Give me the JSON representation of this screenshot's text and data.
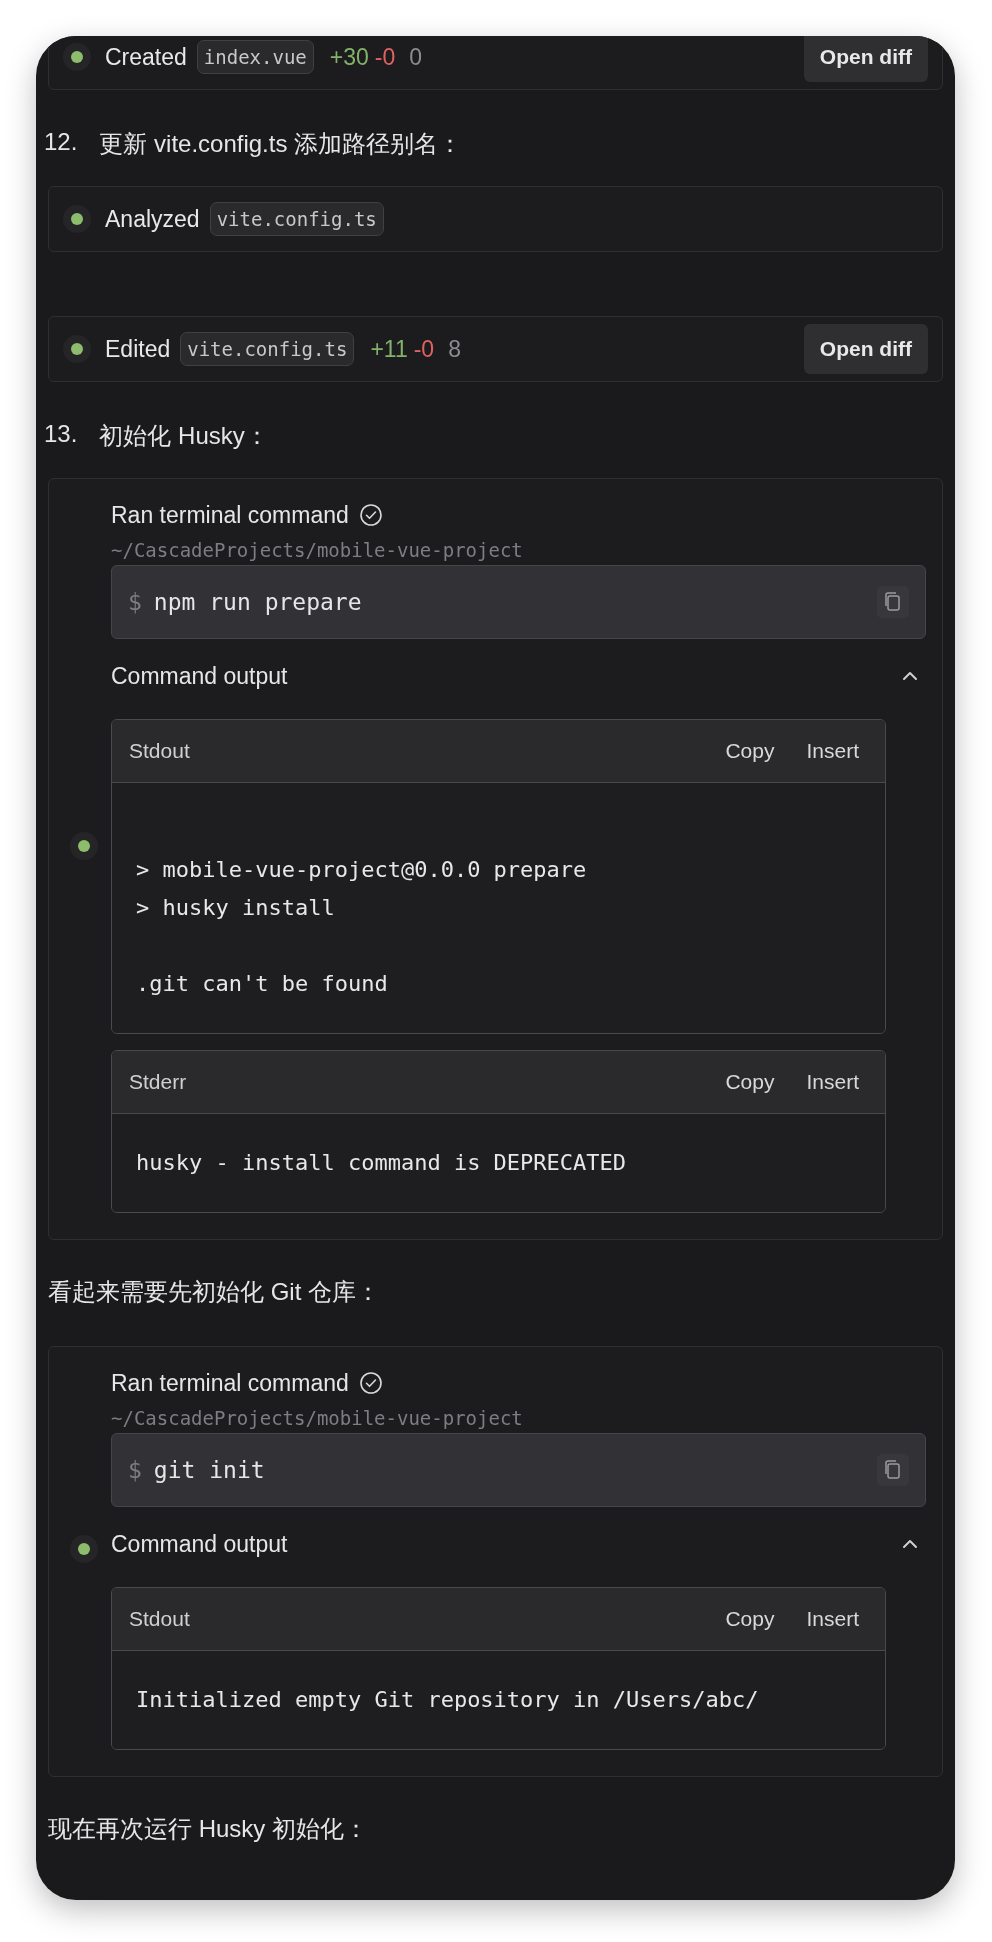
{
  "items": [
    {
      "kind": "file_action",
      "verb": "Created",
      "file": "index.vue",
      "added": "+30",
      "removed": "-0",
      "changed": "0",
      "button": "Open diff"
    },
    {
      "kind": "heading",
      "number": "12.",
      "text": "更新 vite.config.ts 添加路径别名："
    },
    {
      "kind": "file_action",
      "verb": "Analyzed",
      "file": "vite.config.ts"
    },
    {
      "kind": "file_action",
      "verb": "Edited",
      "file": "vite.config.ts",
      "added": "+11",
      "removed": "-0",
      "changed": "8",
      "button": "Open diff"
    },
    {
      "kind": "heading",
      "number": "13.",
      "text": "初始化 Husky："
    },
    {
      "kind": "terminal",
      "title": "Ran terminal command",
      "path": "~/CascadeProjects/mobile-vue-project",
      "prompt": "$",
      "command": "npm run prepare",
      "output_label": "Command output",
      "expanded": true,
      "streams": [
        {
          "label": "Stdout",
          "actions": [
            "Copy",
            "Insert"
          ],
          "text": "\n> mobile-vue-project@0.0.0 prepare\n> husky install\n\n.git can't be found"
        },
        {
          "label": "Stderr",
          "actions": [
            "Copy",
            "Insert"
          ],
          "text": "husky - install command is DEPRECATED"
        }
      ]
    },
    {
      "kind": "paragraph",
      "text": "看起来需要先初始化 Git 仓库："
    },
    {
      "kind": "terminal",
      "title": "Ran terminal command",
      "path": "~/CascadeProjects/mobile-vue-project",
      "prompt": "$",
      "command": "git init",
      "output_label": "Command output",
      "expanded": true,
      "streams": [
        {
          "label": "Stdout",
          "actions": [
            "Copy",
            "Insert"
          ],
          "text": "Initialized empty Git repository in /Users/abc/"
        }
      ]
    },
    {
      "kind": "paragraph",
      "text": "现在再次运行 Husky 初始化："
    }
  ]
}
